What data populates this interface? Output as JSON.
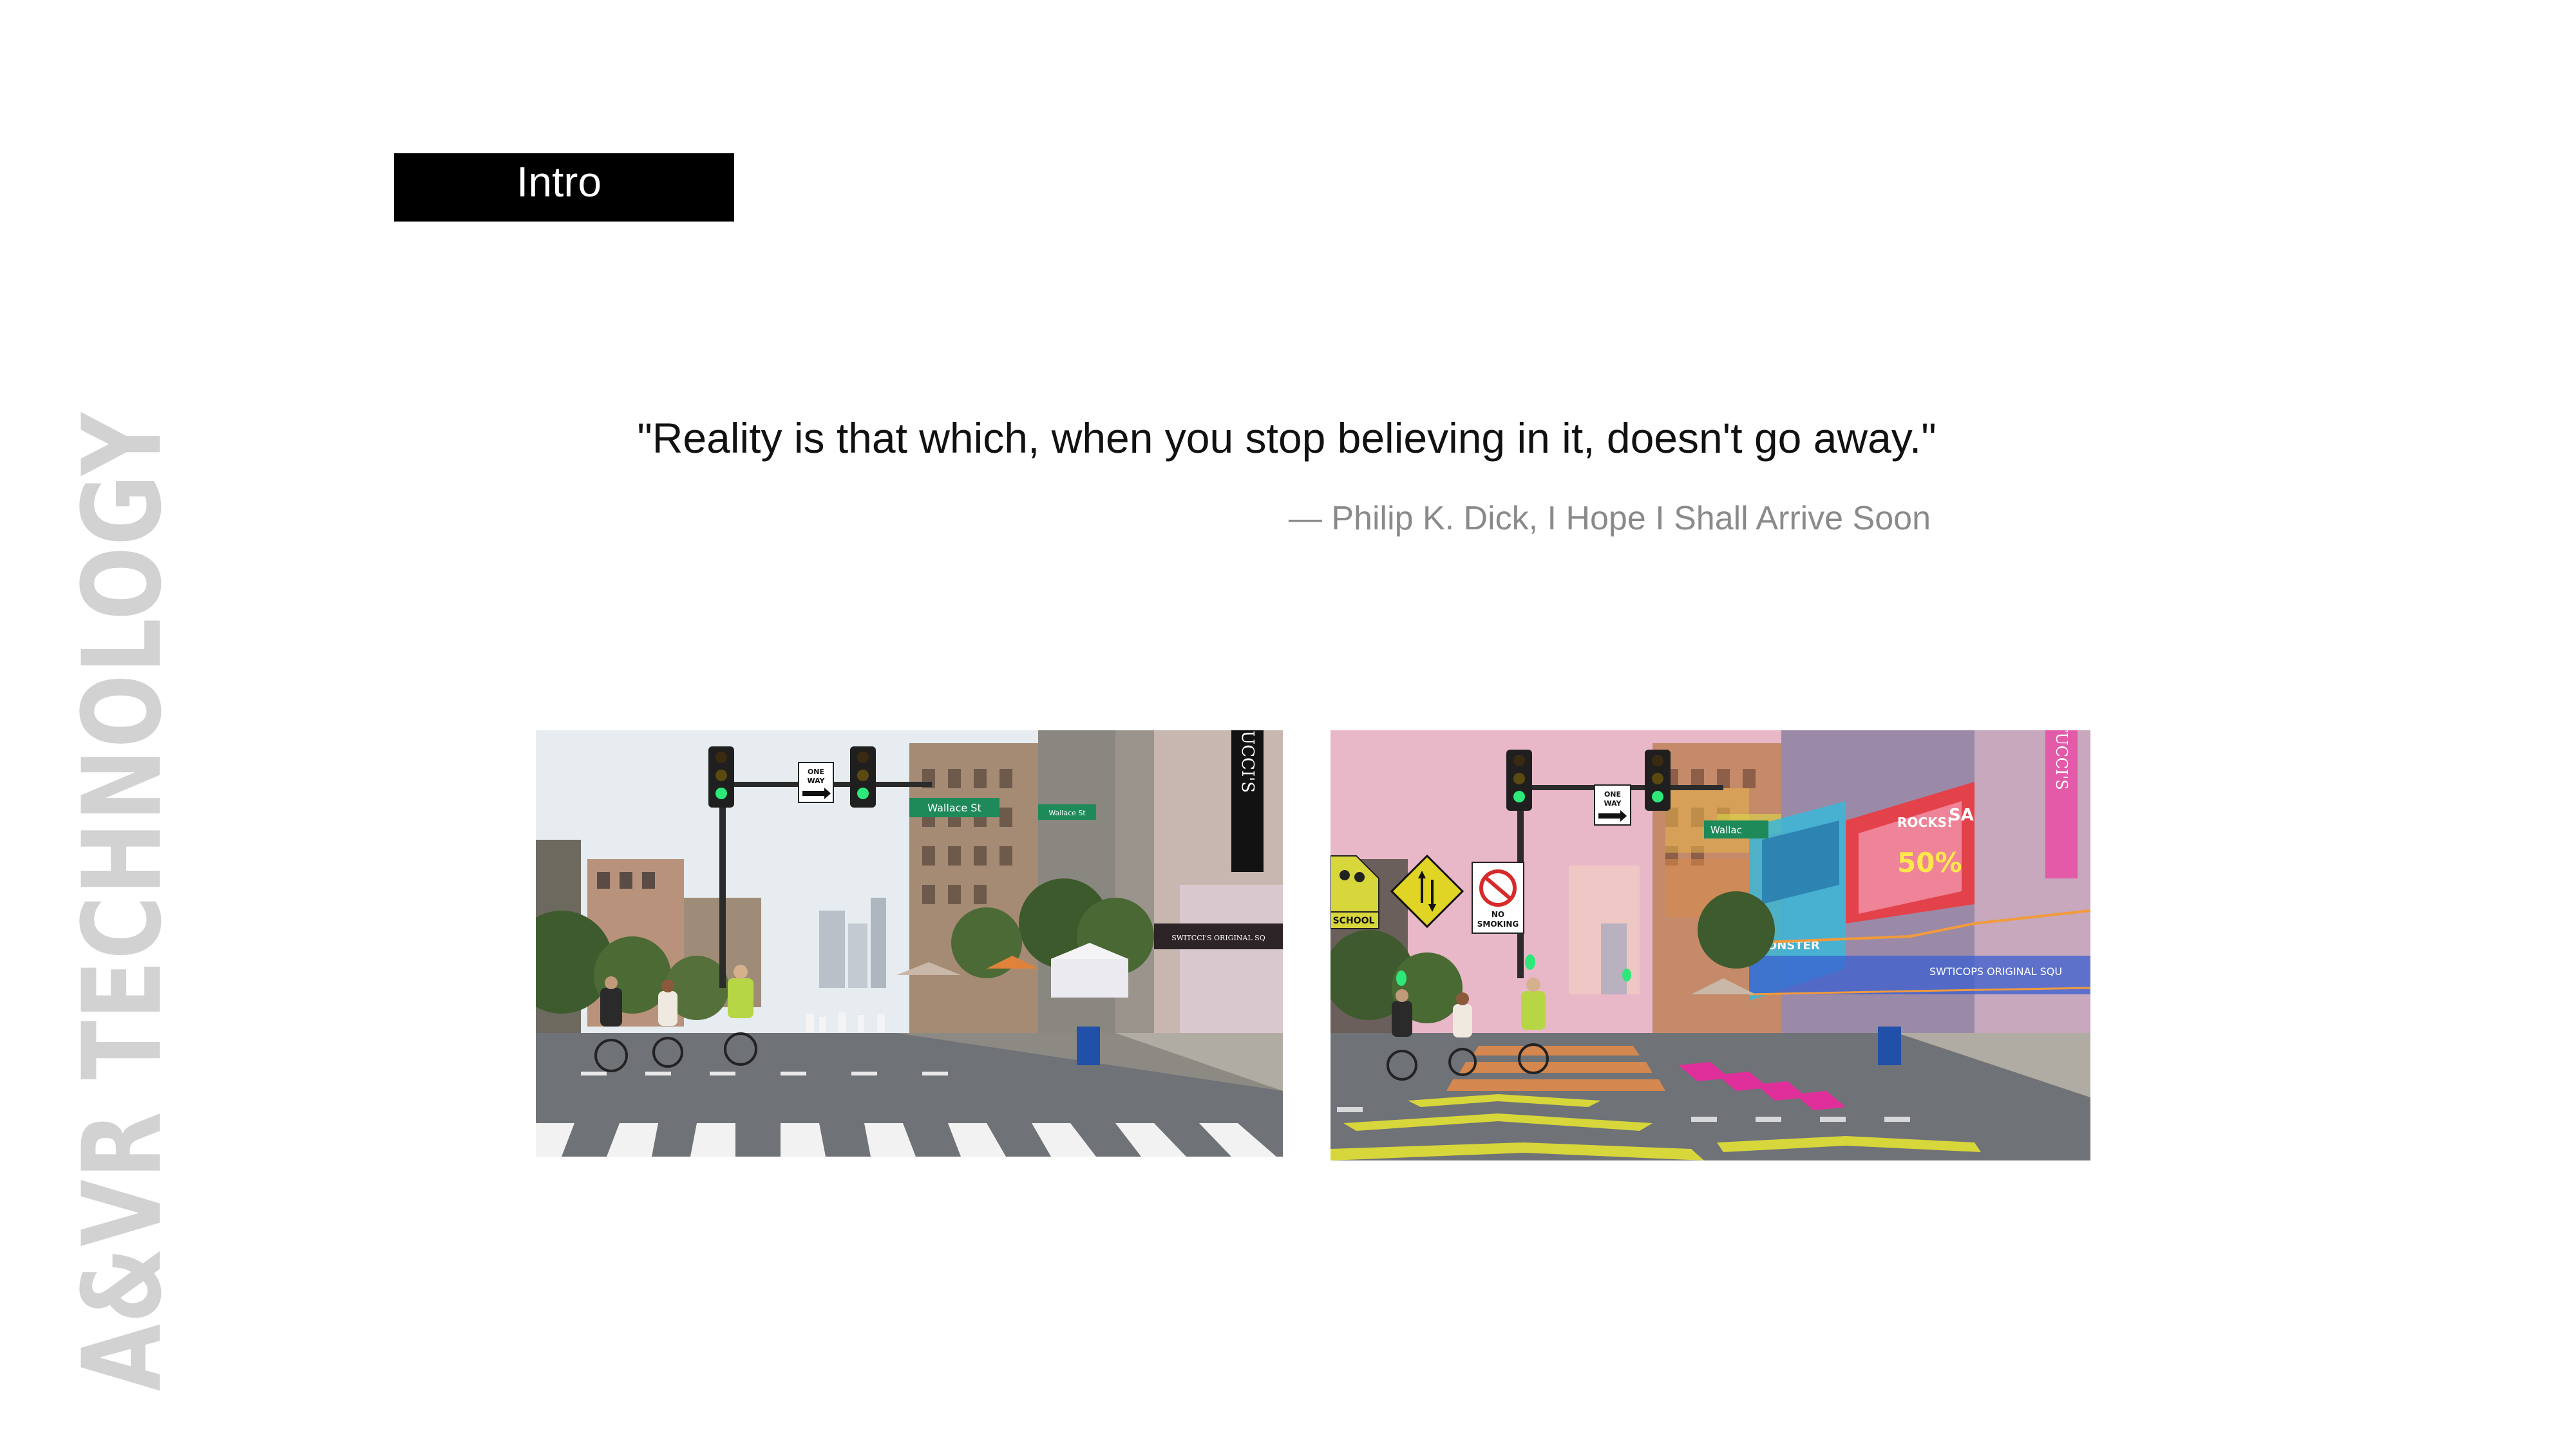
{
  "side_title": "A&VR TECHNOLOGY",
  "section": {
    "label": "Intro"
  },
  "quote": {
    "text": "\"Reality is that which, when you stop believing in it, doesn't go away.\"",
    "attribution": "— Philip K. Dick, I Hope I Shall Arrive Soon"
  },
  "photos": {
    "before": {
      "signs": {
        "one_way_top": "ONE",
        "one_way_bottom": "WAY",
        "street": "Wallace St",
        "street_small": "Wallace St",
        "store_vertical": "TUCCI'S",
        "awning": "SWITCCI'S ORIGINAL SQ"
      }
    },
    "after": {
      "signs": {
        "one_way_top": "ONE",
        "one_way_bottom": "WAY",
        "street": "Wallac",
        "school": "SCHOOL",
        "no_smoking_1": "NO",
        "no_smoking_2": "SMOKING",
        "billboard_1": "ROCKS!",
        "billboard_2": "SALE",
        "billboard_3": "50%",
        "monster": "MONSTER",
        "awning": "SWTICOPS ORIGINAL SQU",
        "store_vertical": "TUCCI'S"
      }
    },
    "colors": {
      "sky": "#e6ecef",
      "sky_ar": "#e9b8c8",
      "asphalt": "#6f7277",
      "crosswalk": "#f2f2f2",
      "building": "#a58a74",
      "ar_yellow": "#d7d63a",
      "ar_orange": "#e08a4a",
      "ar_magenta": "#e02e9a",
      "ar_cyan": "#39b7d8",
      "ar_blue": "#3a5fd0",
      "sign_green": "#1e8a5a",
      "light_green": "#2ee87a"
    }
  }
}
